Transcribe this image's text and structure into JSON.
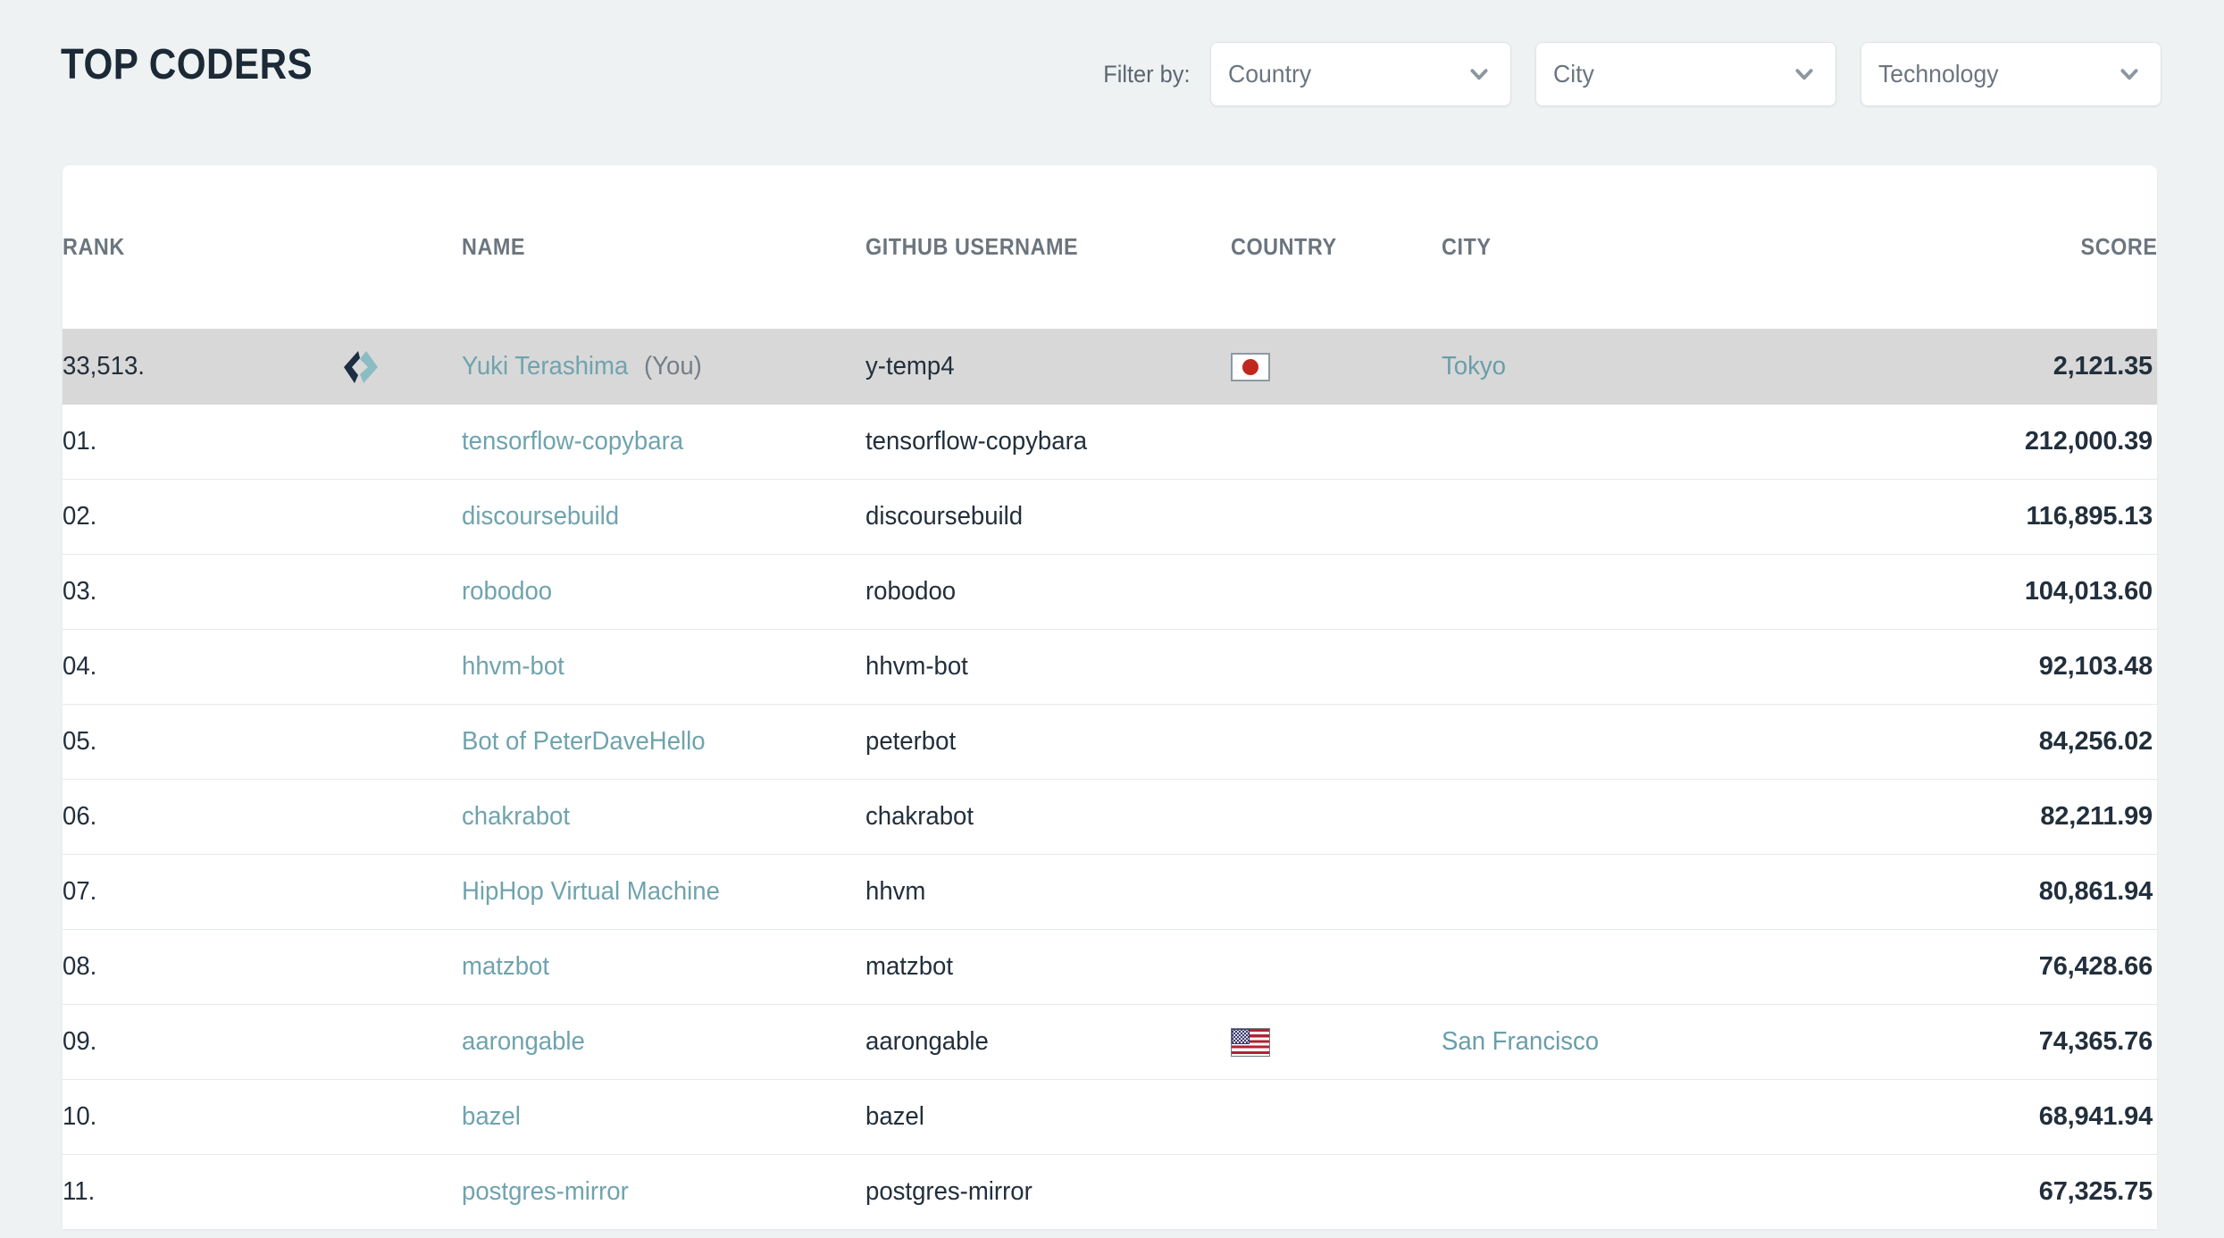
{
  "header": {
    "title": "TOP CODERS",
    "filter_label": "Filter by:",
    "filters": [
      {
        "name": "country",
        "value": "Country"
      },
      {
        "name": "city",
        "value": "City"
      },
      {
        "name": "technology",
        "value": "Technology"
      }
    ]
  },
  "table": {
    "columns": [
      "RANK",
      "NAME",
      "GITHUB USERNAME",
      "COUNTRY",
      "CITY",
      "SCORE"
    ],
    "current_user": {
      "rank": "33,513.",
      "avatar": "code-brackets-logo",
      "name": "Yuki Terashima",
      "you_tag": "(You)",
      "username": "y-temp4",
      "country": "jp",
      "city": "Tokyo",
      "score": "2,121.35"
    },
    "rows": [
      {
        "rank": "01.",
        "name": "tensorflow-copybara",
        "username": "tensorflow-copybara",
        "country": "",
        "city": "",
        "score": "212,000.39"
      },
      {
        "rank": "02.",
        "name": "discoursebuild",
        "username": "discoursebuild",
        "country": "",
        "city": "",
        "score": "116,895.13"
      },
      {
        "rank": "03.",
        "name": "robodoo",
        "username": "robodoo",
        "country": "",
        "city": "",
        "score": "104,013.60"
      },
      {
        "rank": "04.",
        "name": "hhvm-bot",
        "username": "hhvm-bot",
        "country": "",
        "city": "",
        "score": "92,103.48"
      },
      {
        "rank": "05.",
        "name": "Bot of PeterDaveHello",
        "username": "peterbot",
        "country": "",
        "city": "",
        "score": "84,256.02"
      },
      {
        "rank": "06.",
        "name": "chakrabot",
        "username": "chakrabot",
        "country": "",
        "city": "",
        "score": "82,211.99"
      },
      {
        "rank": "07.",
        "name": "HipHop Virtual Machine",
        "username": "hhvm",
        "country": "",
        "city": "",
        "score": "80,861.94"
      },
      {
        "rank": "08.",
        "name": "matzbot",
        "username": "matzbot",
        "country": "",
        "city": "",
        "score": "76,428.66"
      },
      {
        "rank": "09.",
        "name": "aarongable",
        "username": "aarongable",
        "country": "us",
        "city": "San Francisco",
        "score": "74,365.76"
      },
      {
        "rank": "10.",
        "name": "bazel",
        "username": "bazel",
        "country": "",
        "city": "",
        "score": "68,941.94"
      },
      {
        "rank": "11.",
        "name": "postgres-mirror",
        "username": "postgres-mirror",
        "country": "",
        "city": "",
        "score": "67,325.75"
      }
    ]
  },
  "colors": {
    "page_background": "#eff2f3",
    "card_background": "#ffffff",
    "title": "#1c2936",
    "link_teal": "#6fa3ae",
    "header_grey": "#6b757e",
    "highlight_row": "#d8d8d8",
    "score": "#1c2936"
  },
  "icons": {
    "chevron_down": "chevron-down-icon",
    "avatar": "code-brackets-logo",
    "flag_jp": "flag-japan-icon",
    "flag_us": "flag-usa-icon"
  }
}
